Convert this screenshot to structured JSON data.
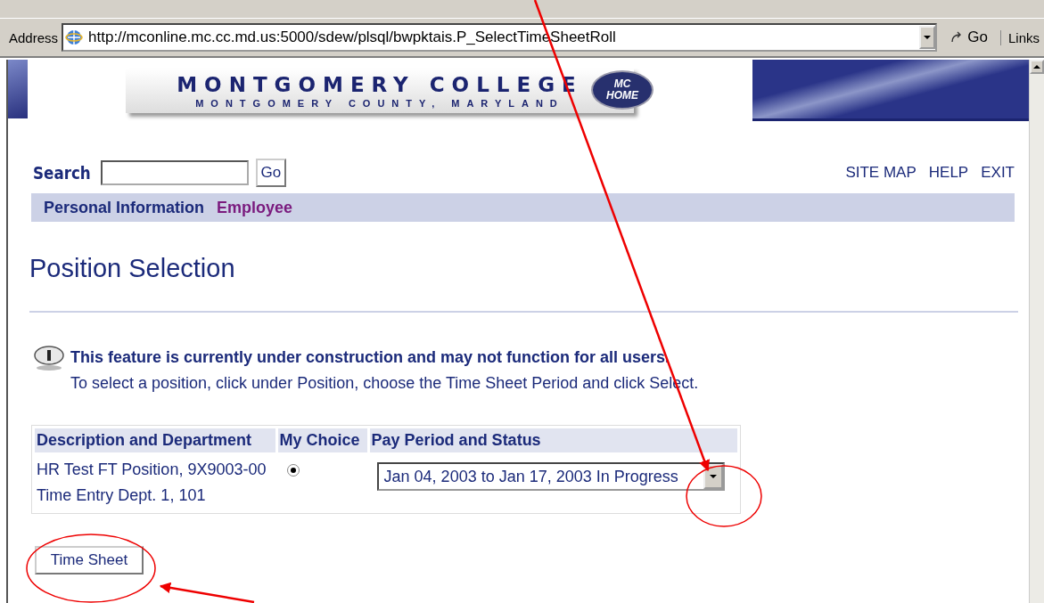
{
  "address_bar": {
    "label": "Address",
    "url": "http://mconline.mc.cc.md.us:5000/sdew/plsql/bwpktais.P_SelectTimeSheetRoll",
    "go": "Go",
    "links": "Links"
  },
  "banner": {
    "title": "MONTGOMERY COLLEGE",
    "subtitle": "MONTGOMERY COUNTY, MARYLAND",
    "badge_top": "MC",
    "badge_bottom": "HOME"
  },
  "search": {
    "label": "Search",
    "button": "Go"
  },
  "top_links": [
    "SITE MAP",
    "HELP",
    "EXIT"
  ],
  "nav": [
    {
      "label": "Personal Information",
      "selected": false
    },
    {
      "label": "Employee",
      "selected": true
    }
  ],
  "page_title": "Position Selection",
  "notice": {
    "heading": "This feature is currently under construction and may not function for all users.",
    "text": "To select a position, click under Position, choose the Time Sheet Period and click Select."
  },
  "table": {
    "columns": [
      "Description and Department",
      "My Choice",
      "Pay Period and Status"
    ],
    "rows": [
      {
        "description": [
          "HR Test FT Position, 9X9003-00",
          "Time Entry Dept. 1, 101"
        ],
        "selected": true,
        "pay_period": "Jan 04, 2003 to Jan 17, 2003 In Progress"
      }
    ]
  },
  "button": "Time Sheet"
}
